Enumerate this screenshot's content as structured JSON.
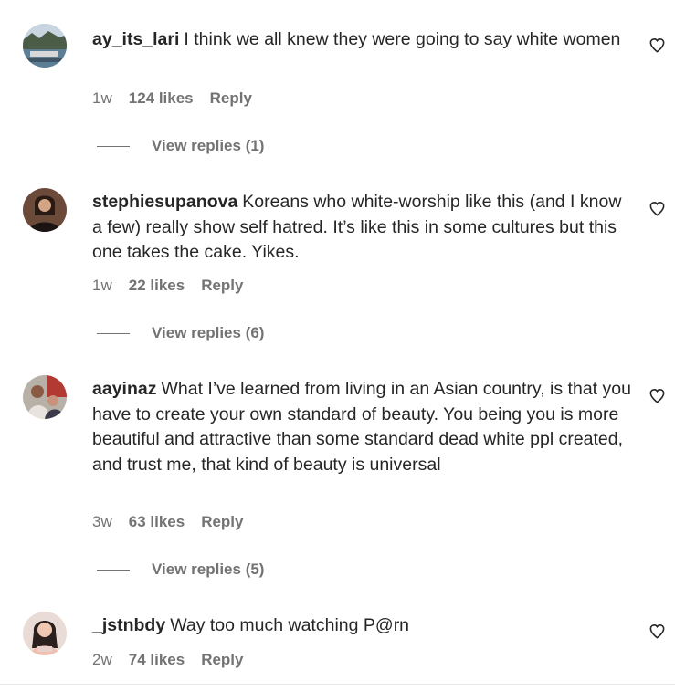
{
  "comments": [
    {
      "username": "ay_its_lari",
      "text": "I think we all knew they were going to say white women",
      "age": "1w",
      "likes": "124 likes",
      "reply": "Reply",
      "view_replies": "View replies (1)"
    },
    {
      "username": "stephiesupanova",
      "text": "Koreans who white-worship like this (and I know a few) really show self hatred. It’s like this in some cultures but this one takes the cake. Yikes.",
      "age": "1w",
      "likes": "22 likes",
      "reply": "Reply",
      "view_replies": "View replies (6)"
    },
    {
      "username": "aayinaz",
      "text": "What I’ve learned from living in an Asian country, is that you have to create your own standard of beauty. You being you is more beautiful and attractive than some standard dead white ppl created, and trust me, that kind of beauty is universal",
      "age": "3w",
      "likes": "63 likes",
      "reply": "Reply",
      "view_replies": "View replies (5)"
    },
    {
      "username": "_jstnbdy",
      "text": "Way too much watching P@rn",
      "age": "2w",
      "likes": "74 likes",
      "reply": "Reply"
    }
  ],
  "icons": {
    "like": "heart-outline-icon"
  },
  "colors": {
    "text": "#262626",
    "secondary": "#737373",
    "background": "#ffffff"
  }
}
